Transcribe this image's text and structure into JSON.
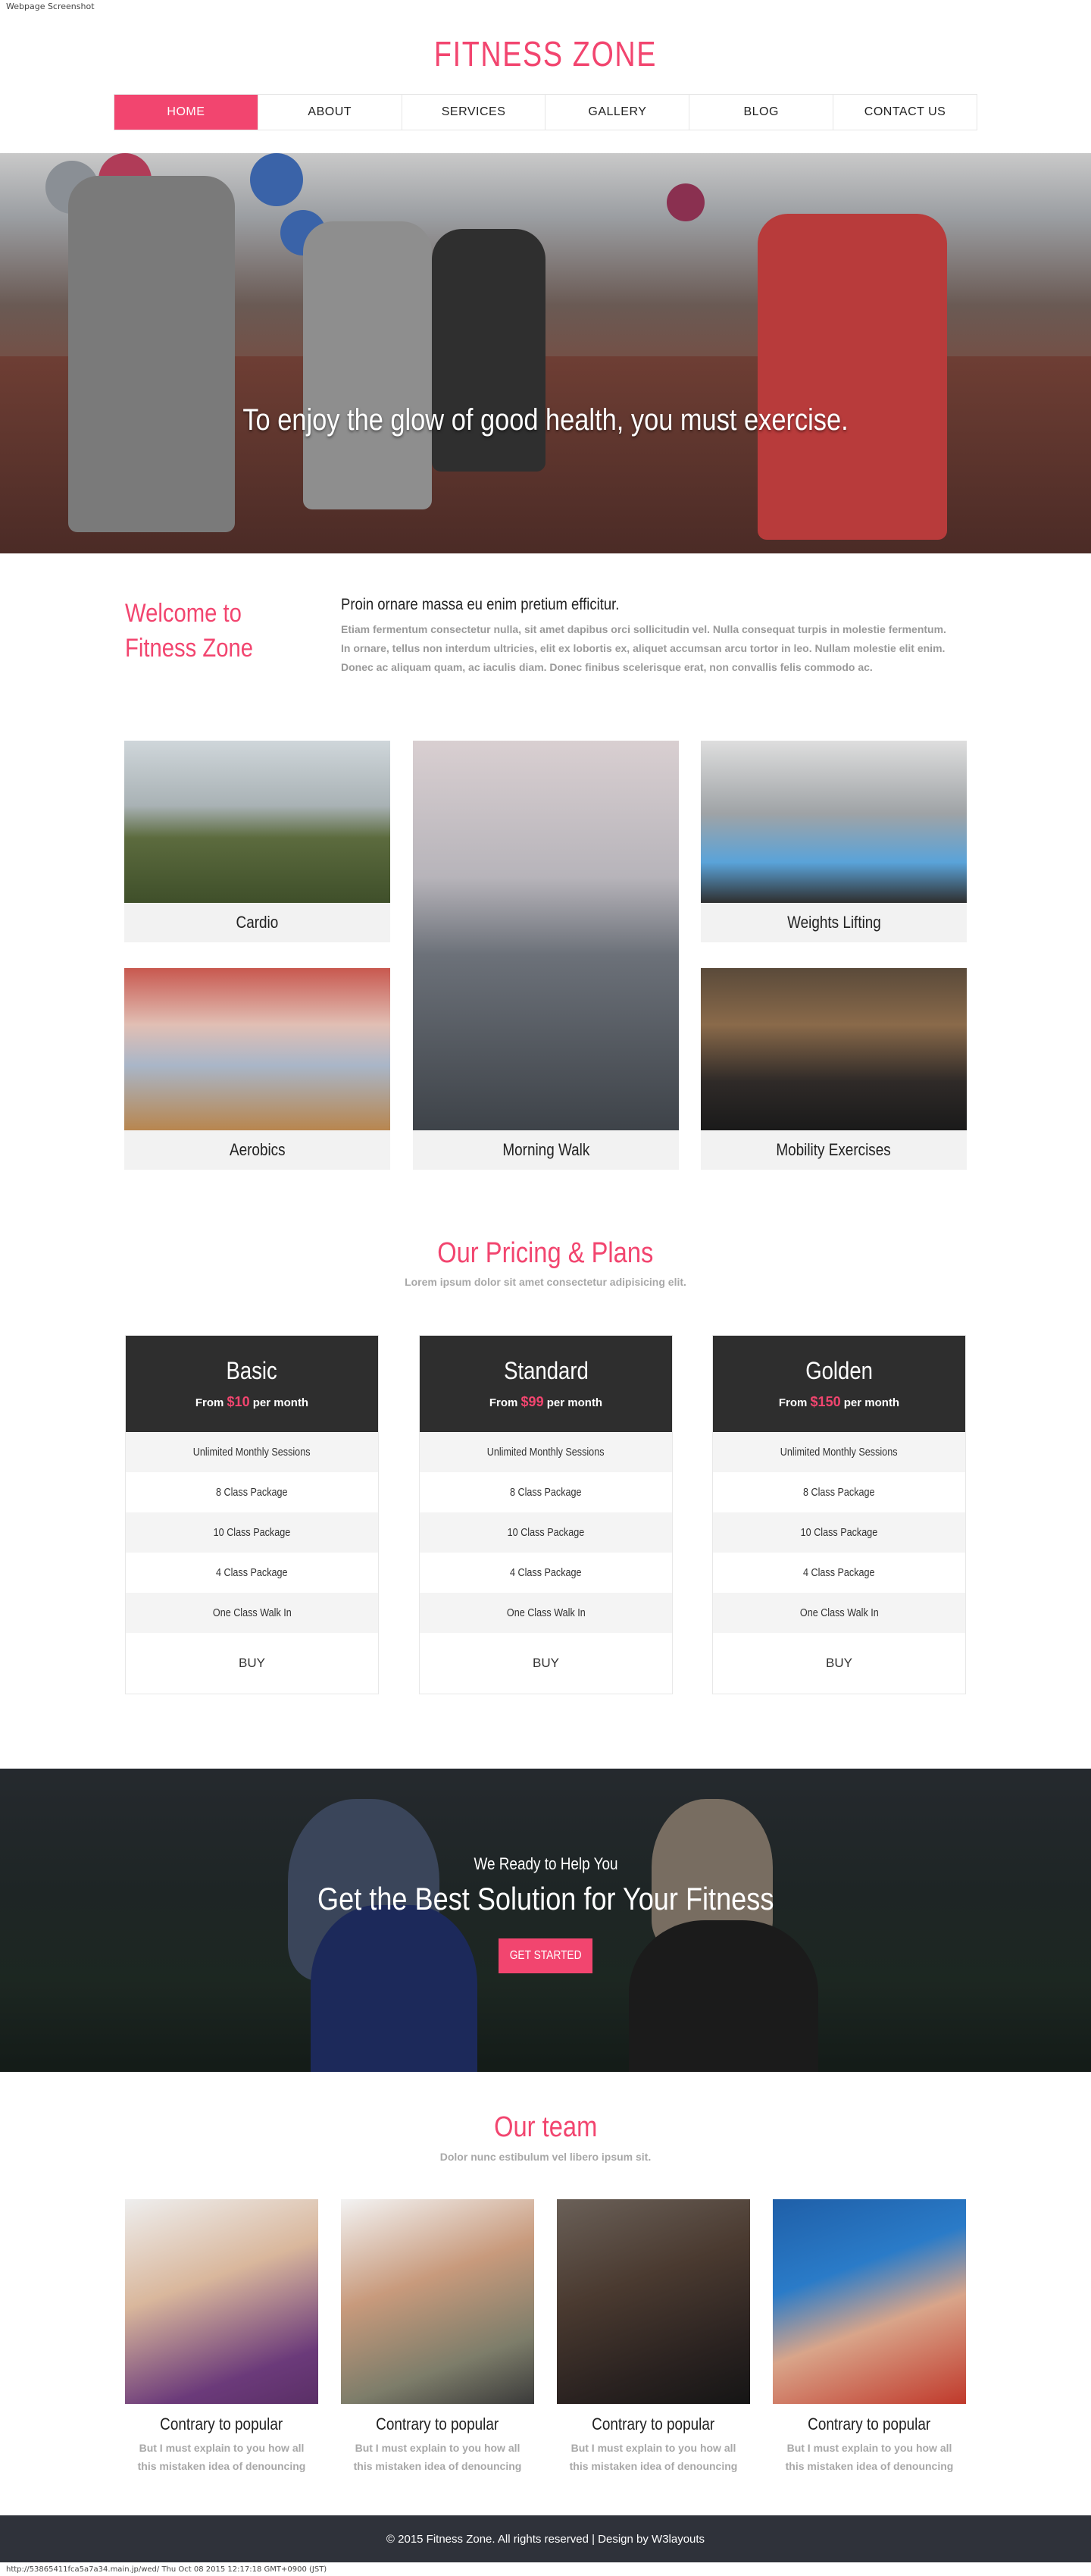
{
  "browser": {
    "caption_top": "Webpage Screenshot",
    "caption_bottom": "http://53865411fca5a7a34.main.jp/wed/ Thu Oct 08 2015 12:17:18 GMT+0900 (JST)"
  },
  "brand": {
    "logo": "FITNESS ZONE",
    "accent": "#f2456f"
  },
  "nav": {
    "items": [
      {
        "label": "HOME"
      },
      {
        "label": "ABOUT"
      },
      {
        "label": "SERVICES"
      },
      {
        "label": "GALLERY"
      },
      {
        "label": "BLOG"
      },
      {
        "label": "CONTACT US"
      }
    ]
  },
  "hero": {
    "text": "To enjoy the glow of good health, you must exercise."
  },
  "welcome": {
    "title": "Welcome to Fitness Zone",
    "subtitle": "Proin ornare massa eu enim pretium efficitur.",
    "body": "Etiam fermentum consectetur nulla, sit amet dapibus orci sollicitudin vel. Nulla consequat turpis in molestie fermentum. In ornare, tellus non interdum ultricies, elit ex lobortis ex, aliquet accumsan arcu tortor in leo. Nullam molestie elit enim. Donec ac aliquam quam, ac iaculis diam. Donec finibus scelerisque erat, non convallis felis commodo ac."
  },
  "services": [
    {
      "label": "Cardio"
    },
    {
      "label": "Morning Walk"
    },
    {
      "label": "Weights Lifting"
    },
    {
      "label": "Aerobics"
    },
    {
      "label": "Mobility Exercises"
    }
  ],
  "pricing": {
    "title": "Our Pricing & Plans",
    "subtitle": "Lorem ipsum dolor sit amet consectetur adipisicing elit.",
    "plans": [
      {
        "name": "Basic",
        "from": "From",
        "amount": "$10",
        "per": "per month",
        "features": [
          "Unlimited Monthly Sessions",
          "8 Class Package",
          "10 Class Package",
          "4 Class Package",
          "One Class Walk In"
        ],
        "buy": "BUY"
      },
      {
        "name": "Standard",
        "from": "From",
        "amount": "$99",
        "per": "per month",
        "features": [
          "Unlimited Monthly Sessions",
          "8 Class Package",
          "10 Class Package",
          "4 Class Package",
          "One Class Walk In"
        ],
        "buy": "BUY"
      },
      {
        "name": "Golden",
        "from": "From",
        "amount": "$150",
        "per": "per month",
        "features": [
          "Unlimited Monthly Sessions",
          "8 Class Package",
          "10 Class Package",
          "4 Class Package",
          "One Class Walk In"
        ],
        "buy": "BUY"
      }
    ]
  },
  "cta": {
    "small": "We Ready to Help You",
    "big": "Get the Best Solution for Your Fitness",
    "button": "GET STARTED"
  },
  "team": {
    "title": "Our team",
    "subtitle": "Dolor nunc estibulum vel libero ipsum sit.",
    "members": [
      {
        "name": "Contrary to popular",
        "desc": "But I must explain to you how all this mistaken idea of denouncing"
      },
      {
        "name": "Contrary to popular",
        "desc": "But I must explain to you how all this mistaken idea of denouncing"
      },
      {
        "name": "Contrary to popular",
        "desc": "But I must explain to you how all this mistaken idea of denouncing"
      },
      {
        "name": "Contrary to popular",
        "desc": "But I must explain to you how all this mistaken idea of denouncing"
      }
    ]
  },
  "footer": {
    "text": "© 2015 Fitness Zone. All rights reserved | Design by W3layouts"
  }
}
